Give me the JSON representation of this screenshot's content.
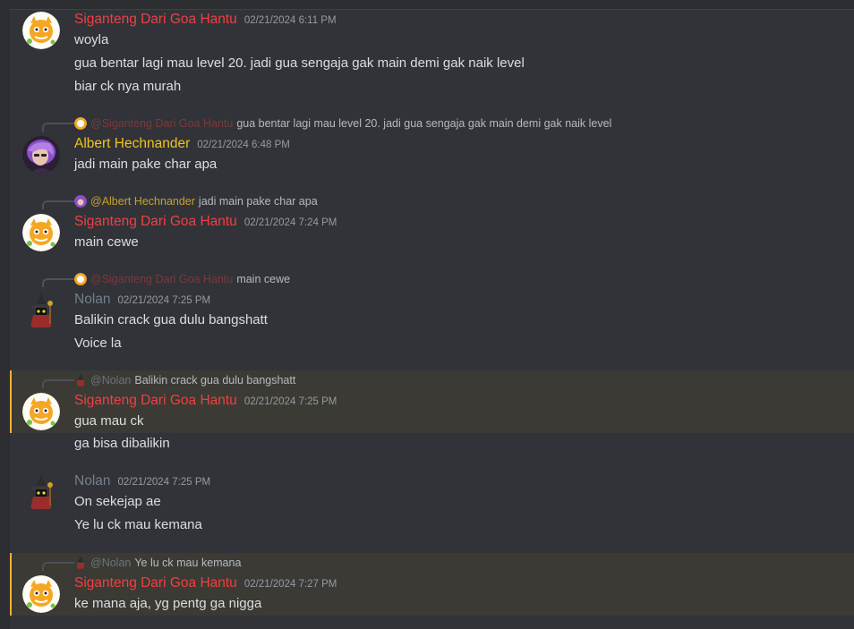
{
  "messages": [
    {
      "author": "Siganteng Dari Goa Hantu",
      "timestamp": "02/21/2024 6:11 PM",
      "lines": [
        "woyla",
        "gua bentar lagi mau level 20. jadi gua sengaja gak main demi gak naik level",
        "biar ck nya murah"
      ]
    },
    {
      "reply": {
        "mention": "@Siganteng Dari Goa Hantu",
        "text": "gua bentar lagi mau level 20. jadi gua sengaja gak main demi gak naik level"
      },
      "author": "Albert Hechnander",
      "timestamp": "02/21/2024 6:48 PM",
      "lines": [
        "jadi main pake char apa"
      ]
    },
    {
      "reply": {
        "mention": "@Albert Hechnander",
        "text": "jadi main pake char apa"
      },
      "author": "Siganteng Dari Goa Hantu",
      "timestamp": "02/21/2024 7:24 PM",
      "lines": [
        "main cewe"
      ]
    },
    {
      "reply": {
        "mention": "@Siganteng Dari Goa Hantu",
        "text": "main cewe"
      },
      "author": "Nolan",
      "timestamp": "02/21/2024 7:25 PM",
      "lines": [
        "Balikin crack gua dulu bangshatt",
        "Voice la"
      ]
    },
    {
      "reply": {
        "mention": "@Nolan",
        "text": "Balikin crack gua dulu bangshatt"
      },
      "author": "Siganteng Dari Goa Hantu",
      "timestamp": "02/21/2024 7:25 PM",
      "lines": [
        "gua mau ck",
        "ga bisa dibalikin"
      ]
    },
    {
      "author": "Nolan",
      "timestamp": "02/21/2024 7:25 PM",
      "lines": [
        "On sekejap ae",
        "Ye lu ck mau kemana"
      ]
    },
    {
      "reply": {
        "mention": "@Nolan",
        "text": "Ye lu ck mau kemana"
      },
      "author": "Siganteng Dari Goa Hantu",
      "timestamp": "02/21/2024 7:27 PM",
      "lines": [
        "ke mana aja, yg pentg ga nigga"
      ]
    }
  ],
  "icons": {
    "siganteng_avatar": "cat-face-avatar-icon",
    "albert_avatar": "purple-hair-portrait-avatar",
    "nolan_avatar": "black-mage-avatar-icon",
    "reply_spine": "reply-spine-icon"
  },
  "colors": {
    "background": "#313338",
    "highlight": "#3b3a34",
    "highlight_bar": "#f0b232",
    "siganteng_name": "#f23f43",
    "albert_name": "#f0c419",
    "nolan_name": "#72808a",
    "timestamp": "#949ba4",
    "text": "#dbdee1"
  }
}
